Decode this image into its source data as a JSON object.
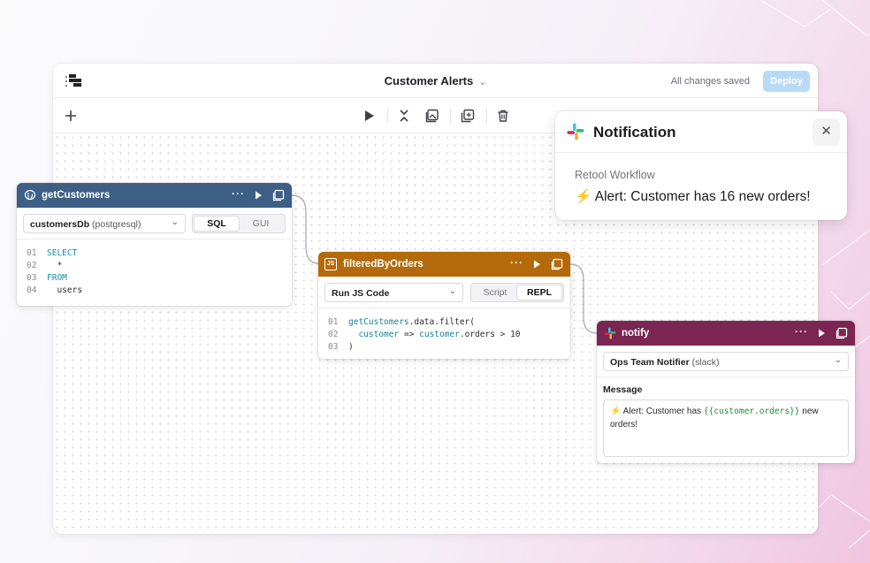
{
  "app": {
    "title": "Customer Alerts",
    "saved_status": "All changes saved",
    "deploy_label": "Deploy"
  },
  "toolbar": {
    "icons": [
      "plus-icon",
      "run-icon",
      "collapse-icon",
      "image-icon",
      "duplicate-icon",
      "trash-icon"
    ]
  },
  "blocks": {
    "get_customers": {
      "name": "getCustomers",
      "header_color": "#3d5f86",
      "resource_name": "customersDb",
      "resource_type": "(postgresql)",
      "modes": [
        "SQL",
        "GUI"
      ],
      "active_mode": "SQL",
      "line_numbers": [
        "01",
        "02",
        "03",
        "04"
      ],
      "code": [
        "SELECT",
        "  *",
        "FROM",
        "  users"
      ]
    },
    "filtered_by_orders": {
      "name": "filteredByOrders",
      "badge": "JS",
      "header_color": "#b46a0a",
      "resource_name": "Run JS Code",
      "modes": [
        "Script",
        "REPL"
      ],
      "active_mode": "REPL",
      "line_numbers": [
        "01",
        "02",
        "03"
      ],
      "code_line1_fn": "getCustomers",
      "code_line1_rest": ".data.filter(",
      "code_line2_arg": "customer",
      "code_line2_arrow": " => ",
      "code_line2_var": "customer",
      "code_line2_rest": ".orders > 10",
      "code_line3": ")"
    },
    "notify": {
      "name": "notify",
      "header_color": "#7b2553",
      "resource_name": "Ops Team Notifier",
      "resource_type": "(slack)",
      "message_label": "Message",
      "message_prefix": "⚡ Alert: Customer has ",
      "message_template": "{{customer.orders}}",
      "message_suffix": " new",
      "message_line2": "orders!"
    }
  },
  "notification": {
    "title": "Notification",
    "source": "Retool Workflow",
    "bolt": "⚡",
    "message": "Alert: Customer has 16 new orders!",
    "close_label": "✕"
  }
}
